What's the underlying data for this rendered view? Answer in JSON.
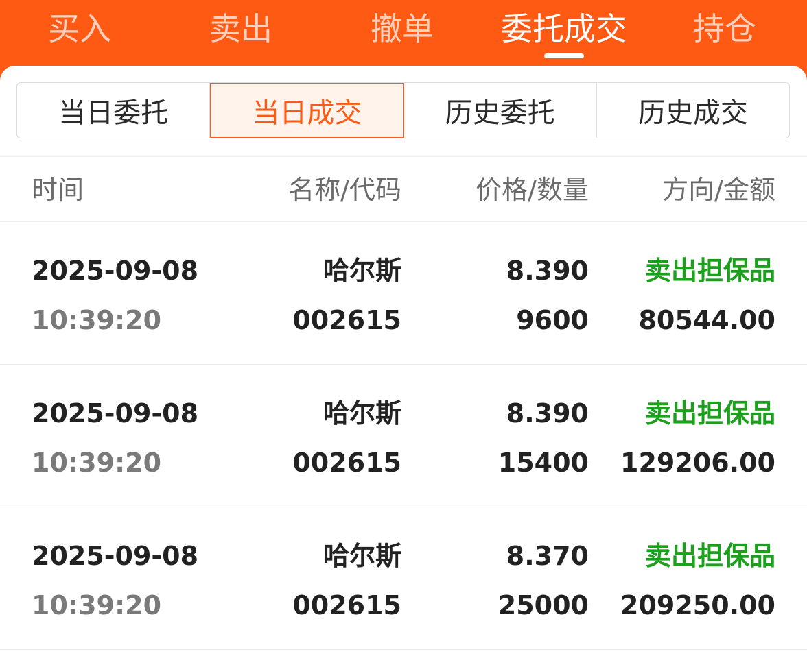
{
  "top_tabs": {
    "items": [
      {
        "label": "买入"
      },
      {
        "label": "卖出"
      },
      {
        "label": "撤单"
      },
      {
        "label": "委托成交"
      },
      {
        "label": "持仓"
      }
    ],
    "active_index": 3
  },
  "segment_tabs": {
    "items": [
      {
        "label": "当日委托"
      },
      {
        "label": "当日成交"
      },
      {
        "label": "历史委托"
      },
      {
        "label": "历史成交"
      }
    ],
    "active_index": 1
  },
  "table": {
    "headers": {
      "time": "时间",
      "name_code": "名称/代码",
      "price_qty": "价格/数量",
      "direction_amount": "方向/金额"
    },
    "rows": [
      {
        "date": "2025-09-08",
        "time": "10:39:20",
        "name": "哈尔斯",
        "code": "002615",
        "price": "8.390",
        "quantity": "9600",
        "direction": "卖出担保品",
        "amount": "80544.00"
      },
      {
        "date": "2025-09-08",
        "time": "10:39:20",
        "name": "哈尔斯",
        "code": "002615",
        "price": "8.390",
        "quantity": "15400",
        "direction": "卖出担保品",
        "amount": "129206.00"
      },
      {
        "date": "2025-09-08",
        "time": "10:39:20",
        "name": "哈尔斯",
        "code": "002615",
        "price": "8.370",
        "quantity": "25000",
        "direction": "卖出担保品",
        "amount": "209250.00"
      }
    ]
  },
  "colors": {
    "brand": "#ff5a14",
    "sell_direction": "#1aa01a"
  }
}
